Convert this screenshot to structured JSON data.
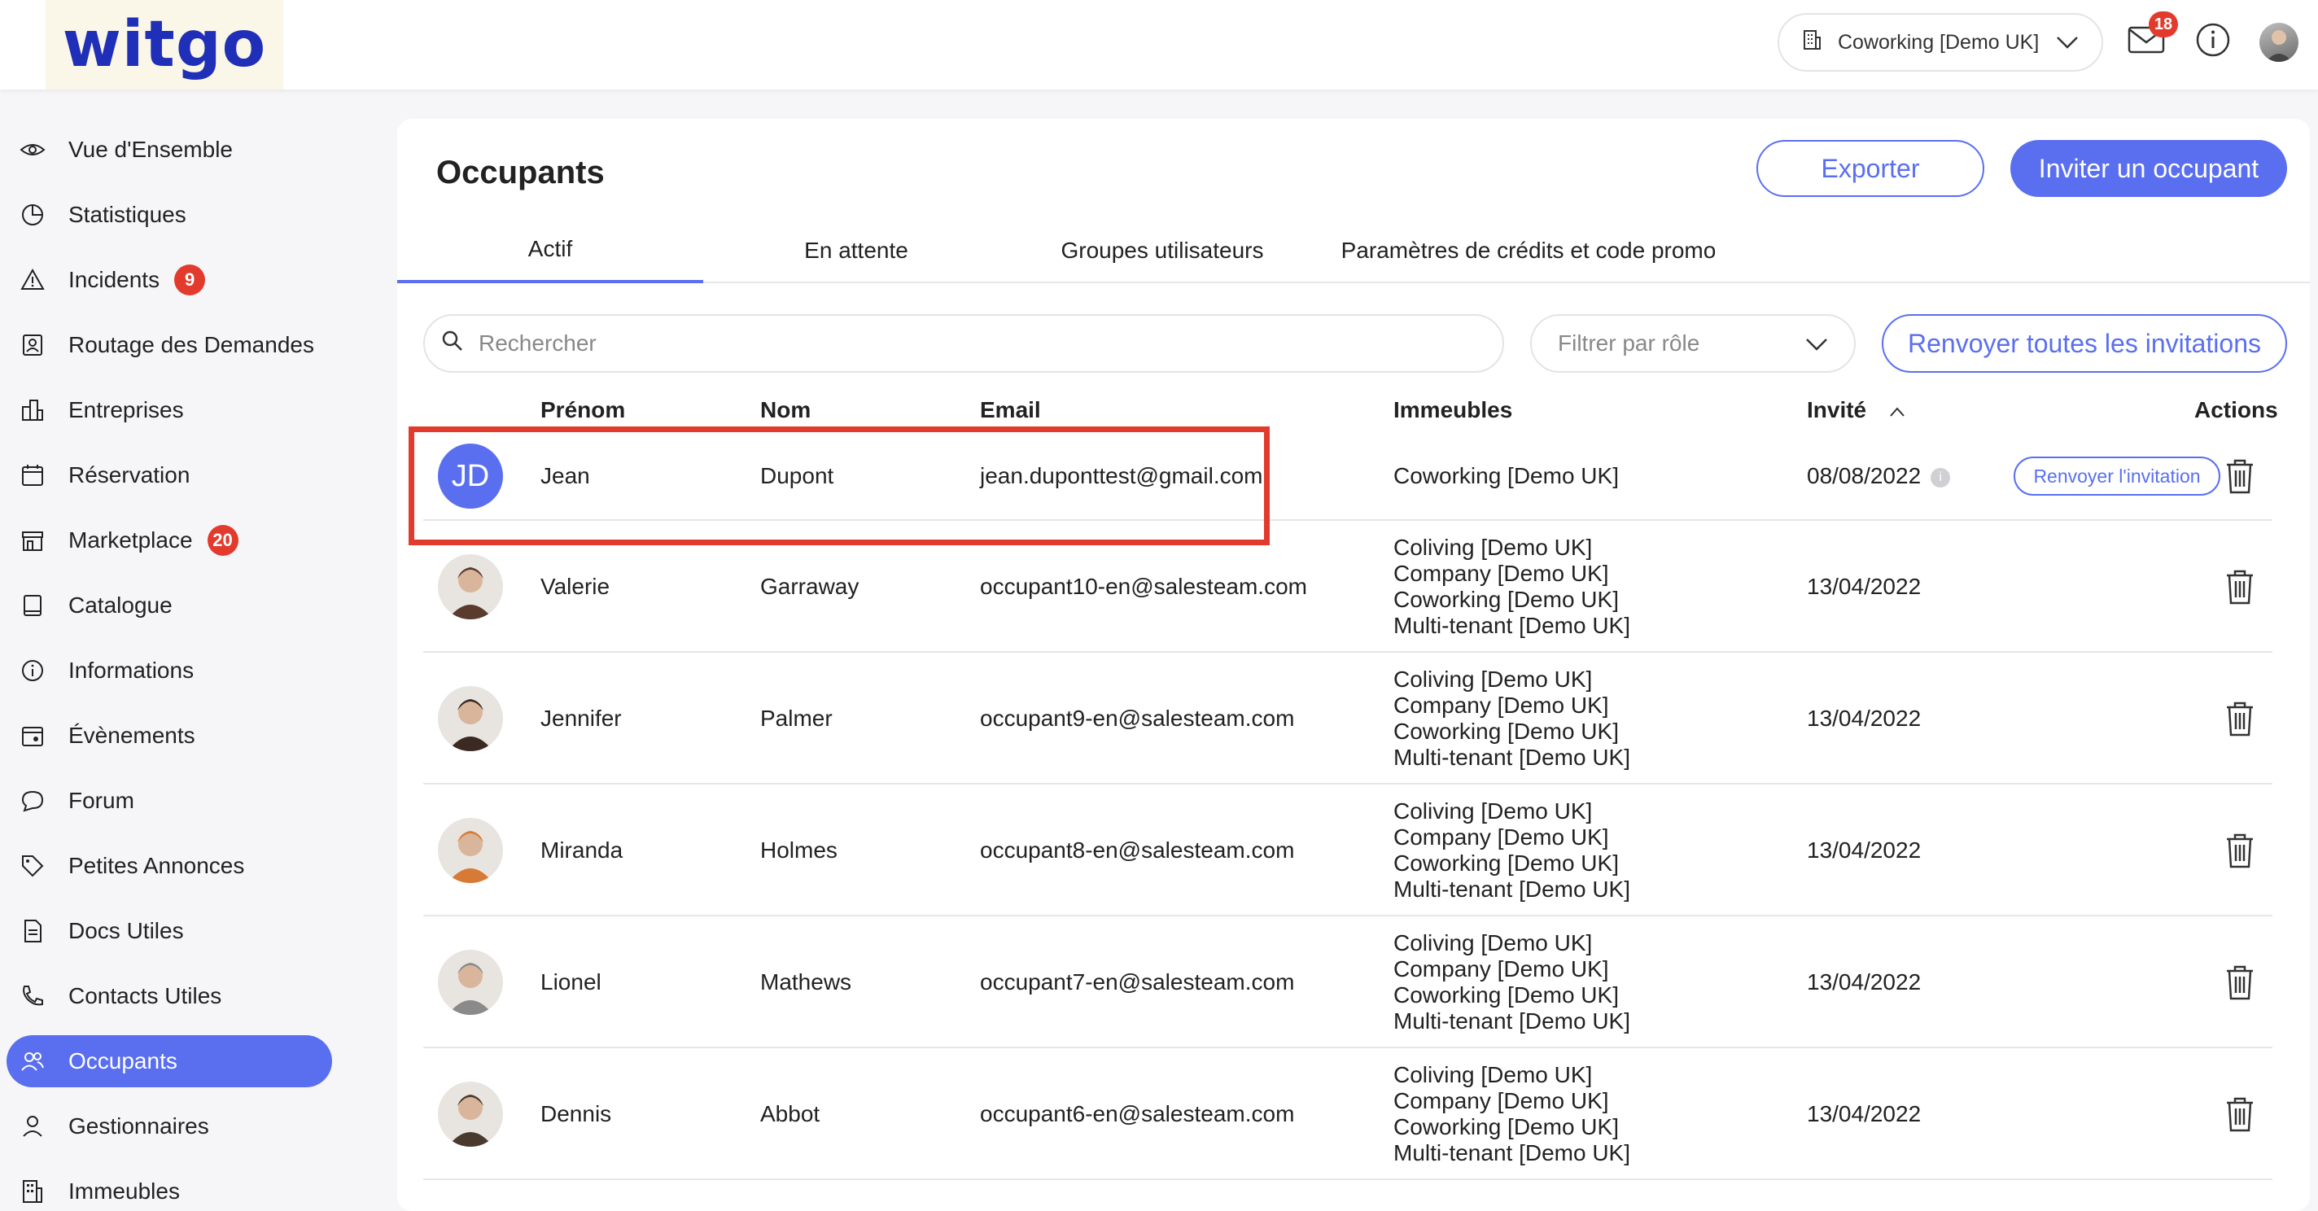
{
  "brand": {
    "logo": "witgo"
  },
  "topbar": {
    "building": "Coworking [Demo UK]",
    "mail_count": "18"
  },
  "sidebar": {
    "items": [
      {
        "label": "Vue d'Ensemble",
        "icon": "eye-icon",
        "badge": ""
      },
      {
        "label": "Statistiques",
        "icon": "pie-chart-icon",
        "badge": ""
      },
      {
        "label": "Incidents",
        "icon": "warning-icon",
        "badge": "9"
      },
      {
        "label": "Routage des Demandes",
        "icon": "contact-card-icon",
        "badge": ""
      },
      {
        "label": "Entreprises",
        "icon": "city-icon",
        "badge": ""
      },
      {
        "label": "Réservation",
        "icon": "calendar-icon",
        "badge": ""
      },
      {
        "label": "Marketplace",
        "icon": "store-icon",
        "badge": "20"
      },
      {
        "label": "Catalogue",
        "icon": "book-icon",
        "badge": ""
      },
      {
        "label": "Informations",
        "icon": "info-icon",
        "badge": ""
      },
      {
        "label": "Évènements",
        "icon": "event-calendar-icon",
        "badge": ""
      },
      {
        "label": "Forum",
        "icon": "chat-bubble-icon",
        "badge": ""
      },
      {
        "label": "Petites Annonces",
        "icon": "tag-icon",
        "badge": ""
      },
      {
        "label": "Docs Utiles",
        "icon": "document-icon",
        "badge": ""
      },
      {
        "label": "Contacts Utiles",
        "icon": "phone-sos-icon",
        "badge": ""
      },
      {
        "label": "Occupants",
        "icon": "users-icon",
        "badge": ""
      },
      {
        "label": "Gestionnaires",
        "icon": "user-icon",
        "badge": ""
      },
      {
        "label": "Immeubles",
        "icon": "building-icon",
        "badge": ""
      }
    ],
    "active_index": 14
  },
  "main": {
    "title": "Occupants",
    "export_label": "Exporter",
    "invite_label": "Inviter un occupant",
    "tabs": [
      {
        "label": "Actif"
      },
      {
        "label": "En attente"
      },
      {
        "label": "Groupes utilisateurs"
      },
      {
        "label": "Paramètres de crédits et code promo"
      }
    ],
    "active_tab": 0,
    "search_placeholder": "Rechercher",
    "filter_placeholder": "Filtrer par rôle",
    "resend_all_label": "Renvoyer toutes les invitations",
    "columns": {
      "first_name": "Prénom",
      "last_name": "Nom",
      "email": "Email",
      "buildings": "Immeubles",
      "invited": "Invité",
      "actions": "Actions"
    },
    "rows": [
      {
        "initials": "JD",
        "first_name": "Jean",
        "last_name": "Dupont",
        "email": "jean.duponttest@gmail.com",
        "buildings": [
          "Coworking [Demo UK]"
        ],
        "invited": "08/08/2022",
        "resend_label": "Renvoyer l'invitation"
      },
      {
        "initials": "",
        "first_name": "Valerie",
        "last_name": "Garraway",
        "email": "occupant10-en@salesteam.com",
        "buildings": [
          "Coliving [Demo UK]",
          "Company [Demo UK]",
          "Coworking [Demo UK]",
          "Multi-tenant [Demo UK]"
        ],
        "invited": "13/04/2022",
        "resend_label": ""
      },
      {
        "initials": "",
        "first_name": "Jennifer",
        "last_name": "Palmer",
        "email": "occupant9-en@salesteam.com",
        "buildings": [
          "Coliving [Demo UK]",
          "Company [Demo UK]",
          "Coworking [Demo UK]",
          "Multi-tenant [Demo UK]"
        ],
        "invited": "13/04/2022",
        "resend_label": ""
      },
      {
        "initials": "",
        "first_name": "Miranda",
        "last_name": "Holmes",
        "email": "occupant8-en@salesteam.com",
        "buildings": [
          "Coliving [Demo UK]",
          "Company [Demo UK]",
          "Coworking [Demo UK]",
          "Multi-tenant [Demo UK]"
        ],
        "invited": "13/04/2022",
        "resend_label": ""
      },
      {
        "initials": "",
        "first_name": "Lionel",
        "last_name": "Mathews",
        "email": "occupant7-en@salesteam.com",
        "buildings": [
          "Coliving [Demo UK]",
          "Company [Demo UK]",
          "Coworking [Demo UK]",
          "Multi-tenant [Demo UK]"
        ],
        "invited": "13/04/2022",
        "resend_label": ""
      },
      {
        "initials": "",
        "first_name": "Dennis",
        "last_name": "Abbot",
        "email": "occupant6-en@salesteam.com",
        "buildings": [
          "Coliving [Demo UK]",
          "Company [Demo UK]",
          "Coworking [Demo UK]",
          "Multi-tenant [Demo UK]"
        ],
        "invited": "13/04/2022",
        "resend_label": ""
      }
    ]
  },
  "colors": {
    "accent": "#5a6ff0",
    "badge": "#e23b2e",
    "highlight": "#e23b2e",
    "logo": "#1f2fb8"
  }
}
